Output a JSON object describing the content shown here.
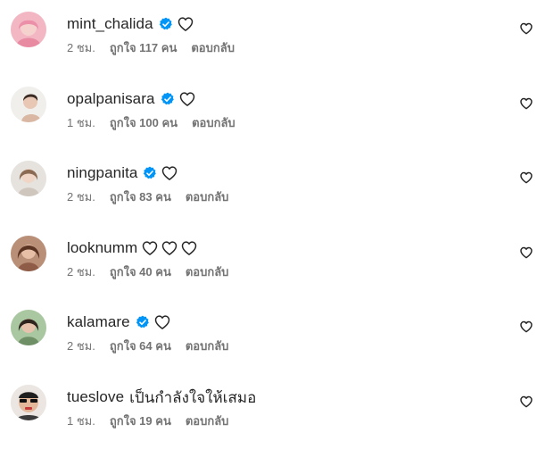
{
  "colors": {
    "verified": "#0095f6",
    "text": "#262626",
    "secondary": "#737373"
  },
  "icons": {
    "verified": "verified-badge-icon",
    "heart": "heart-outline-icon"
  },
  "comments": [
    {
      "username": "mint_chalida",
      "verified": true,
      "text": "",
      "inline_hearts": 1,
      "time": "2 ชม.",
      "likes": "ถูกใจ 117 คน",
      "reply": "ตอบกลับ"
    },
    {
      "username": "opalpanisara",
      "verified": true,
      "text": "",
      "inline_hearts": 1,
      "time": "1 ชม.",
      "likes": "ถูกใจ 100 คน",
      "reply": "ตอบกลับ"
    },
    {
      "username": "ningpanita",
      "verified": true,
      "text": "",
      "inline_hearts": 1,
      "time": "2 ชม.",
      "likes": "ถูกใจ 83 คน",
      "reply": "ตอบกลับ"
    },
    {
      "username": "looknumm",
      "verified": false,
      "text": "",
      "inline_hearts": 3,
      "time": "2 ชม.",
      "likes": "ถูกใจ 40 คน",
      "reply": "ตอบกลับ"
    },
    {
      "username": "kalamare",
      "verified": true,
      "text": "",
      "inline_hearts": 1,
      "time": "2 ชม.",
      "likes": "ถูกใจ 64 คน",
      "reply": "ตอบกลับ"
    },
    {
      "username": "tueslove",
      "verified": false,
      "text": "เป็นกำลังใจให้เสมอ",
      "inline_hearts": 0,
      "time": "1 ชม.",
      "likes": "ถูกใจ 19 คน",
      "reply": "ตอบกลับ"
    }
  ]
}
